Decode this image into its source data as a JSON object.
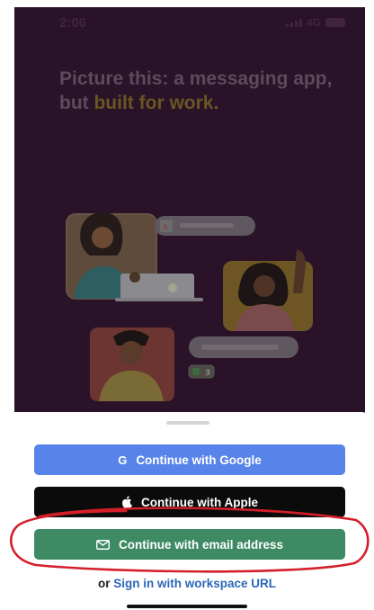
{
  "status_bar": {
    "time": "2:06",
    "network": "4G"
  },
  "hero": {
    "headline_part1": "Picture this: a messaging app, but ",
    "headline_accent": "built for work."
  },
  "illustration": {
    "reaction_count": "3"
  },
  "auth": {
    "google_label": "Continue with Google",
    "google_icon": "G",
    "apple_label": "Continue with Apple",
    "email_label": "Continue with email address",
    "alt_prefix": "or ",
    "alt_link": "Sign in with workspace URL"
  },
  "colors": {
    "google": "#5883e8",
    "apple": "#0b0b0b",
    "email": "#3d8a64",
    "link": "#2b68b7",
    "annotation": "#d41f2b",
    "headline_accent": "#6b5523"
  }
}
